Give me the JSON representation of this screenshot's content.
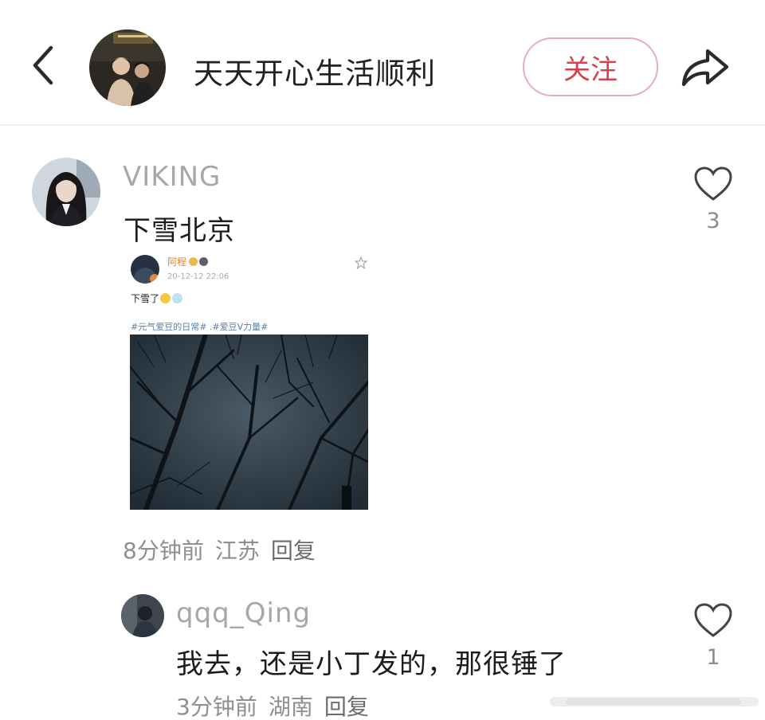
{
  "header": {
    "title": "天天开心生活顺利",
    "follow_label": "关注"
  },
  "comments": [
    {
      "username": "VIKING",
      "text": "下雪北京",
      "time": "8分钟前",
      "location": "江苏",
      "reply_label": "回复",
      "likes": "3",
      "embed": {
        "name": "阿程",
        "time": "20-12-12 22:06",
        "text": "下雪了",
        "tags": "#元气爱豆的日常# .#爱豆V力量#"
      }
    },
    {
      "username": "qqq_Qing",
      "text": "我去，还是小丁发的，那很锤了",
      "time": "3分钟前",
      "location": "湖南",
      "reply_label": "回复",
      "likes": "1"
    }
  ],
  "colors": {
    "follow_text": "#d6434f",
    "follow_border": "#e6aeb2",
    "username": "#a7a7a7",
    "meta": "#8f8f8f"
  },
  "icons": [
    "back-arrow-icon",
    "share-icon",
    "heart-icon",
    "star-icon"
  ]
}
